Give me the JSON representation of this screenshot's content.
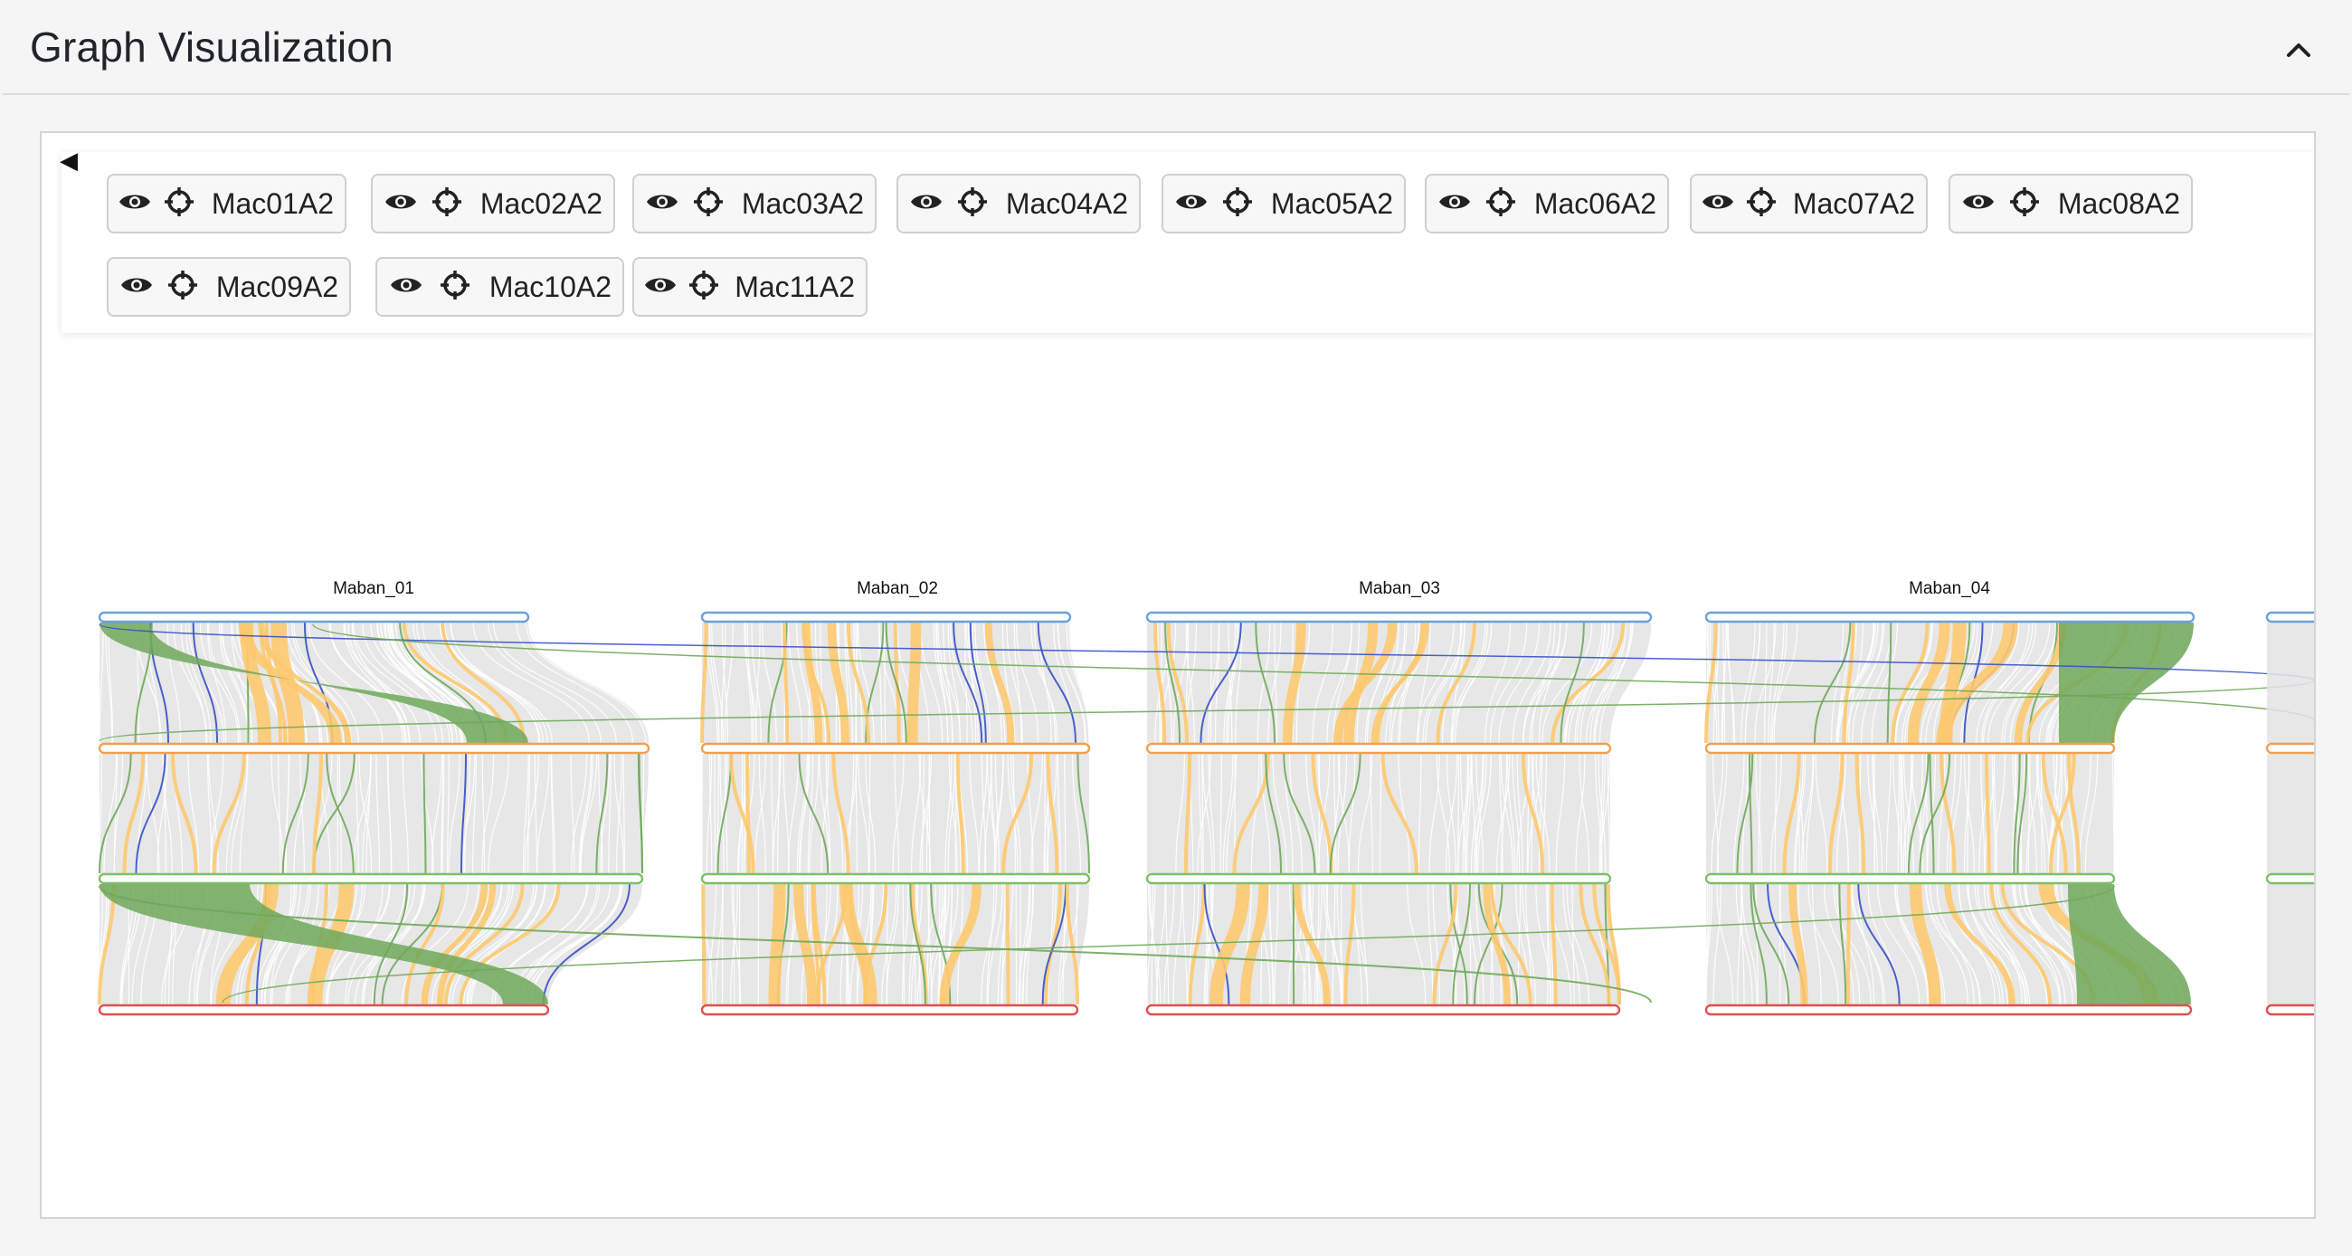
{
  "panel": {
    "title": "Graph Visualization"
  },
  "icons": {
    "collapse": "chevron-up-icon",
    "toggle": "caret-left-icon",
    "visibility": "eye-icon",
    "locate": "crosshair-icon"
  },
  "toolbar": {
    "toggle_glyph": "◀",
    "samples": [
      {
        "label": "Mac01A2"
      },
      {
        "label": "Mac02A2"
      },
      {
        "label": "Mac03A2"
      },
      {
        "label": "Mac04A2"
      },
      {
        "label": "Mac05A2"
      },
      {
        "label": "Mac06A2"
      },
      {
        "label": "Mac07A2"
      },
      {
        "label": "Mac08A2"
      },
      {
        "label": "Mac09A2"
      },
      {
        "label": "Mac10A2"
      },
      {
        "label": "Mac11A2"
      }
    ]
  },
  "graph": {
    "chromosomes": [
      {
        "name": "Maban_01"
      },
      {
        "name": "Maban_02"
      },
      {
        "name": "Maban_03"
      },
      {
        "name": "Maban_04"
      }
    ],
    "colors": {
      "track_1": "#6aa2dc",
      "track_2": "#f0a050",
      "track_3": "#7fbf6a",
      "track_4": "#e05050",
      "link_gray": "#e3e3e3",
      "link_orange": "#fdc96f",
      "link_green": "#6ea85a",
      "link_blue": "#3550c8"
    }
  }
}
